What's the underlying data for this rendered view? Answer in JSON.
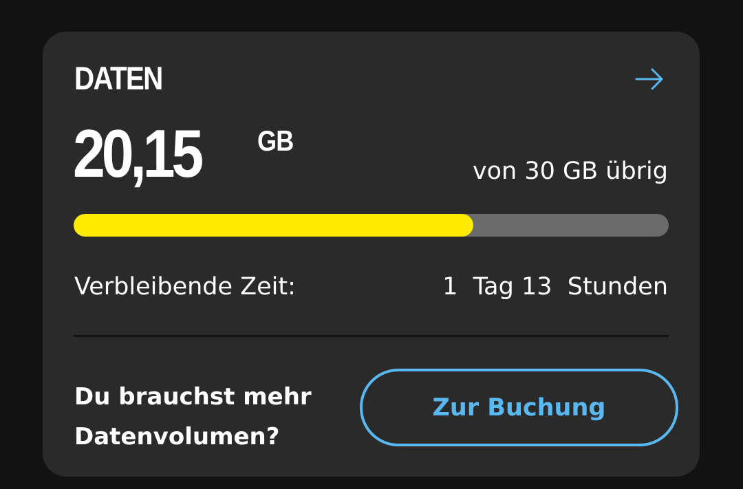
{
  "card": {
    "title": "DATEN",
    "arrow_icon": "arrow-right-icon",
    "amount": "20,15",
    "unit": "GB",
    "remaining_text": "von 30 GB übrig",
    "progress_fraction": 0.6717,
    "time_label": "Verbleibende Zeit:",
    "time_value": "1  Tag 13  Stunden",
    "promo_line1": "Du brauchst mehr",
    "promo_line2": "Datenvolumen?",
    "cta_label": "Zur Buchung"
  },
  "colors": {
    "background": "#121212",
    "card": "#2a2a2a",
    "accent_blue": "#5ab8f0",
    "progress_fill": "#ffea00",
    "progress_track": "#6b6b6b"
  }
}
